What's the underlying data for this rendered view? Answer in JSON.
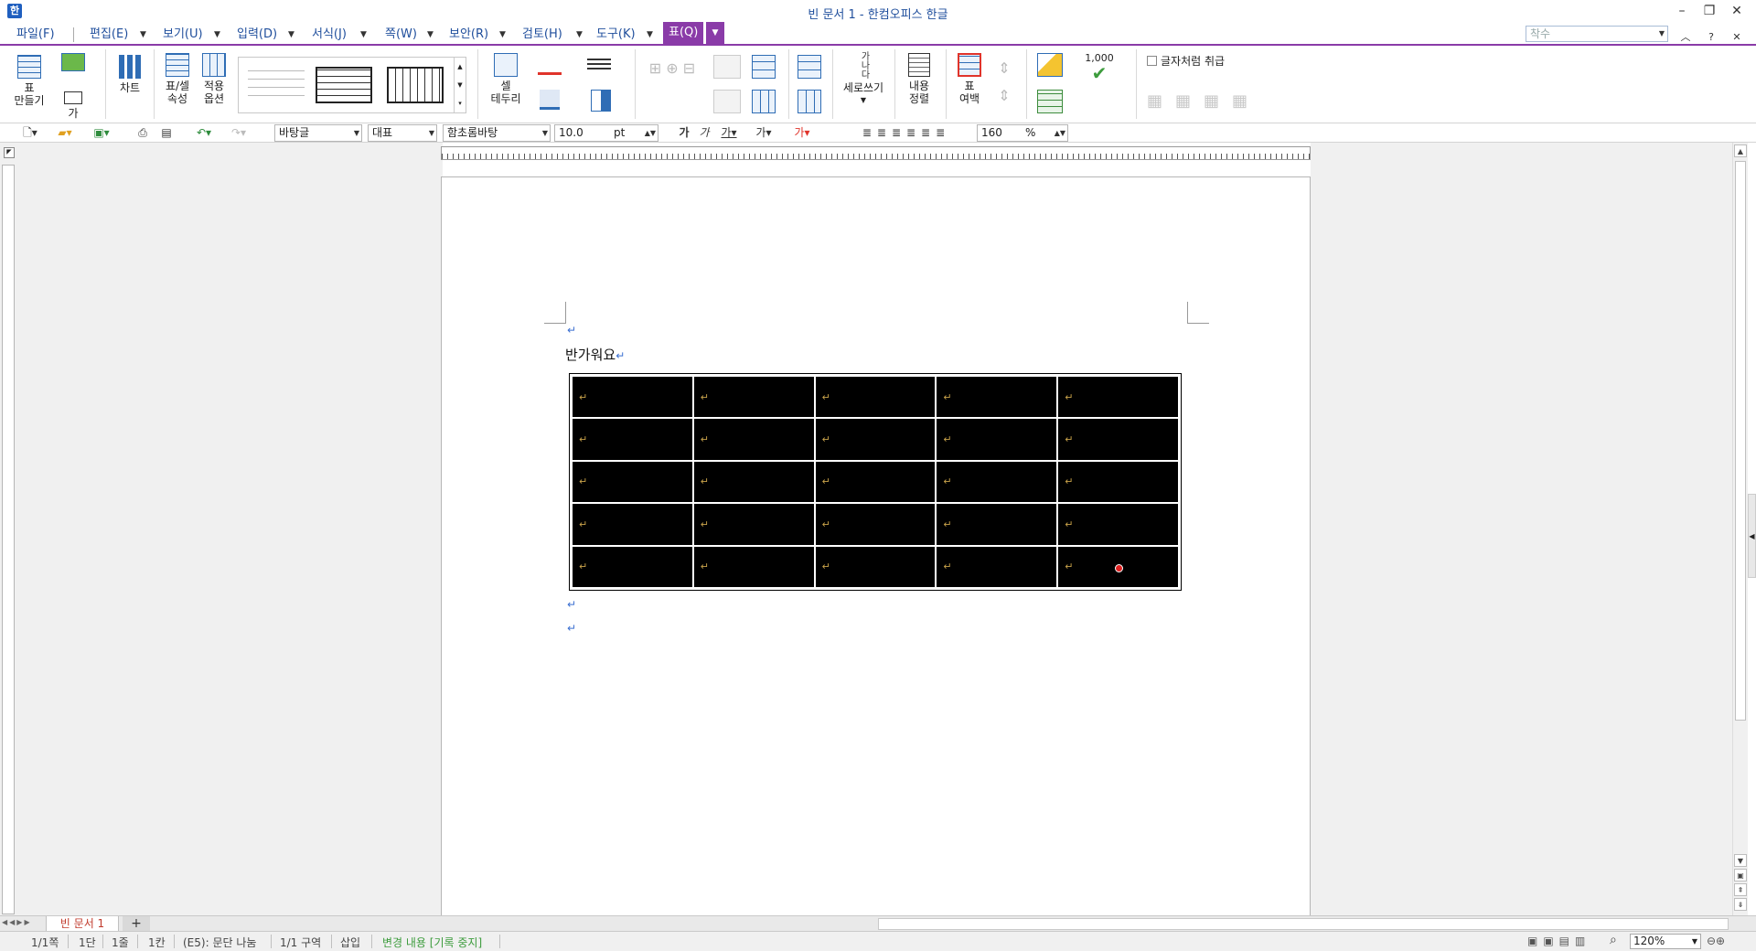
{
  "window": {
    "title": "빈 문서 1 - 한컴오피스 한글",
    "app_icon": "한"
  },
  "menu": {
    "items": [
      "파일(F)",
      "편집(E)",
      "보기(U)",
      "입력(D)",
      "서식(J)",
      "쪽(W)",
      "보안(R)",
      "검토(H)",
      "도구(K)",
      "표(Q)"
    ],
    "active": "표(Q)",
    "search_placeholder": "착수"
  },
  "ribbon": {
    "table_make": "표\n만들기",
    "ga": "가",
    "chart": "차트",
    "cell_props": "표/셀\n속성",
    "apply_option": "적용\n옵션",
    "cell_border": "셀\n테두리",
    "vertical_write": "세로쓰기",
    "content_align": "내용\n정렬",
    "table_margin": "표\n여백",
    "thousand": "1,000",
    "treat_as_char": "글자처럼 취급",
    "ga_na_da": "가나다"
  },
  "toolbar": {
    "style": "바탕글",
    "lang": "대표",
    "font": "함초롬바탕",
    "size": "10.0",
    "unit": "pt",
    "line_spacing": "160",
    "percent": "%"
  },
  "document": {
    "text": "반가워요",
    "para_mark": "↵",
    "table": {
      "rows": 5,
      "cols": 5,
      "cell_mark": "↵"
    }
  },
  "tabs": {
    "doc": "빈 문서 1",
    "add": "+"
  },
  "status": {
    "page": "1/1쪽",
    "column": "1단",
    "line": "1줄",
    "pos": "1칸",
    "cell": "(E5): 문단 나눔",
    "section": "1/1 구역",
    "mode": "삽입",
    "track": "변경 내용 [기록 중지]",
    "zoom": "120%"
  }
}
